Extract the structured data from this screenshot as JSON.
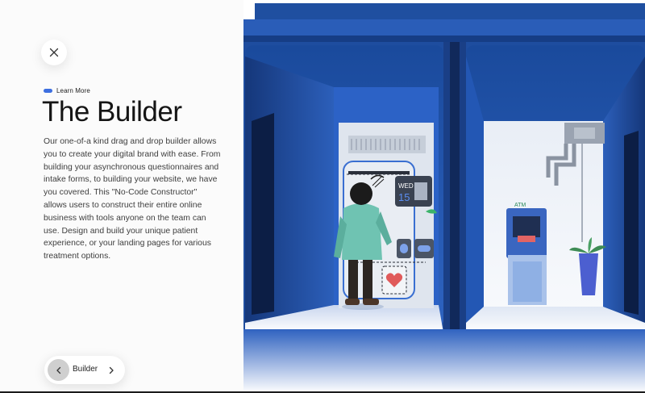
{
  "header": {
    "close_icon": "close-icon"
  },
  "eyebrow": {
    "label": "Learn More",
    "accent_color": "#3d6fe0"
  },
  "title": "The Builder",
  "description": "Our one-of-a kind drag and drop builder allows you to create your digital brand with ease. From building your asynchronous questionnaires and intake forms, to building your website, we have you covered. This \"No-Code Constructor\" allows users to construct their entire online business with tools anyone on the team can use. Design and build your unique patient experience, or your landing pages for various treatment options.",
  "nav": {
    "label": "Builder",
    "prev_icon": "chevron-left-icon",
    "next_icon": "chevron-right-icon"
  },
  "illustration": {
    "calendar_day": "WED",
    "calendar_date": "15",
    "atm_sign": "ATM",
    "colors": {
      "wall_blue": "#1f4fa0",
      "light_blue": "#3a73d3",
      "floor": "#e8eef8"
    }
  }
}
